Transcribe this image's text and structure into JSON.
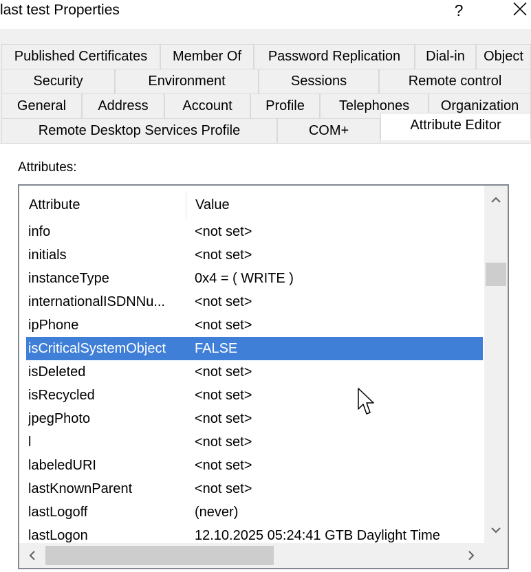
{
  "window": {
    "title": "last test Properties",
    "help_label": "?"
  },
  "tabs": {
    "row1": [
      "Published Certificates",
      "Member Of",
      "Password Replication",
      "Dial-in",
      "Object"
    ],
    "row2": [
      "Security",
      "Environment",
      "Sessions",
      "Remote control"
    ],
    "row3": [
      "General",
      "Address",
      "Account",
      "Profile",
      "Telephones",
      "Organization"
    ],
    "row4": [
      "Remote Desktop Services Profile",
      "COM+",
      "Attribute Editor"
    ],
    "active": "Attribute Editor"
  },
  "attributes": {
    "label": "Attributes:",
    "columns": [
      "Attribute",
      "Value"
    ],
    "selected_index": 5,
    "rows": [
      {
        "attribute": "info",
        "value": "<not set>"
      },
      {
        "attribute": "initials",
        "value": "<not set>"
      },
      {
        "attribute": "instanceType",
        "value": "0x4 = ( WRITE )"
      },
      {
        "attribute": "internationalISDNNu...",
        "value": "<not set>"
      },
      {
        "attribute": "ipPhone",
        "value": "<not set>"
      },
      {
        "attribute": "isCriticalSystemObject",
        "value": "FALSE"
      },
      {
        "attribute": "isDeleted",
        "value": "<not set>"
      },
      {
        "attribute": "isRecycled",
        "value": "<not set>"
      },
      {
        "attribute": "jpegPhoto",
        "value": "<not set>"
      },
      {
        "attribute": "l",
        "value": "<not set>"
      },
      {
        "attribute": "labeledURI",
        "value": "<not set>"
      },
      {
        "attribute": "lastKnownParent",
        "value": "<not set>"
      },
      {
        "attribute": "lastLogoff",
        "value": "(never)"
      },
      {
        "attribute": "lastLogon",
        "value": "12.10.2025 05:24:41 GTB Daylight Time"
      }
    ]
  },
  "icons": {
    "close": "close-icon",
    "scroll_up": "chevron-up-icon",
    "scroll_down": "chevron-down-icon",
    "scroll_left": "chevron-left-icon",
    "scroll_right": "chevron-right-icon",
    "cursor": "mouse-pointer-icon"
  },
  "colors": {
    "selection": "#3f7fd8",
    "dialog_bg": "#f0f0f0",
    "list_border": "#828790"
  }
}
